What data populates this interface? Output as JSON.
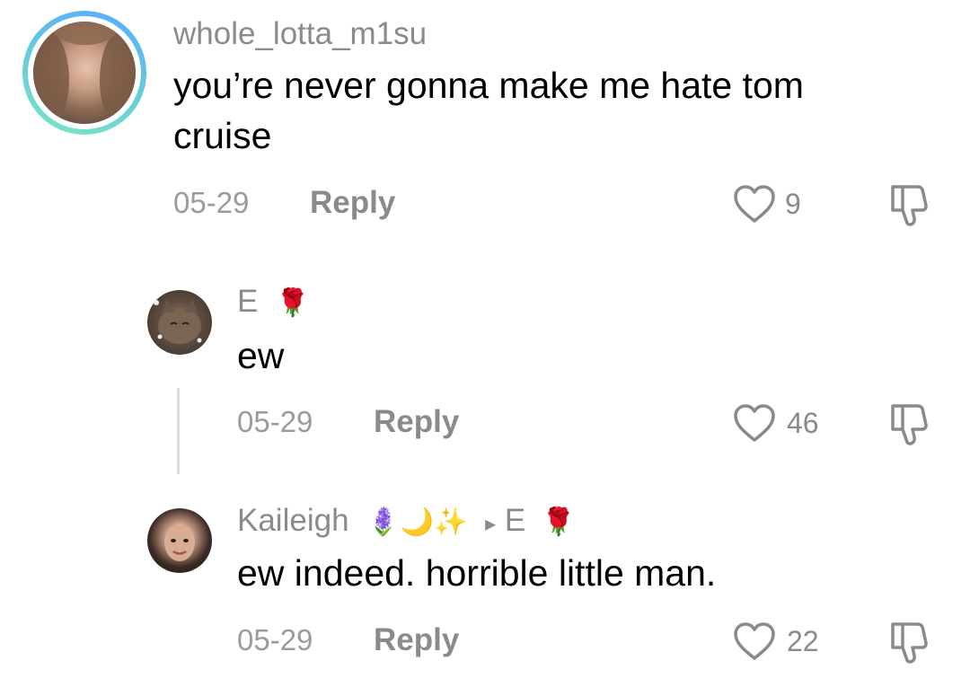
{
  "comments": [
    {
      "username": "whole_lotta_m1su",
      "text_line1": "you’re never gonna make me hate tom",
      "text_line2": "cruise",
      "date": "05-29",
      "reply_label": "Reply",
      "likes": "9"
    },
    {
      "username": "E",
      "username_emoji": "🌹",
      "text": "ew",
      "date": "05-29",
      "reply_label": "Reply",
      "likes": "46"
    },
    {
      "username": "Kaileigh",
      "username_emojis": "🪻🌙✨",
      "reply_to_arrow": "▸",
      "reply_to": "E",
      "reply_to_emoji": "🌹",
      "text": "ew indeed. horrible little man.",
      "date": "05-29",
      "reply_label": "Reply",
      "likes": "22"
    }
  ]
}
